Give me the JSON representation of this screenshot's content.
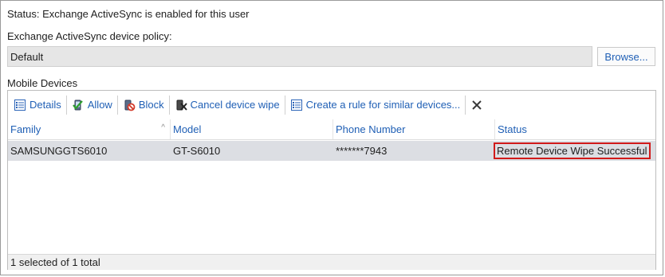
{
  "status_text": "Status: Exchange ActiveSync is enabled for this user",
  "policy": {
    "label": "Exchange ActiveSync device policy:",
    "value": "Default",
    "browse_label": "Browse..."
  },
  "devices": {
    "label": "Mobile Devices",
    "toolbar": {
      "details": "Details",
      "allow": "Allow",
      "block": "Block",
      "cancel_wipe": "Cancel device wipe",
      "create_rule": "Create a rule for similar devices..."
    },
    "columns": [
      "Family",
      "Model",
      "Phone Number",
      "Status"
    ],
    "rows": [
      {
        "family": "SAMSUNGGTS6010",
        "model": "GT-S6010",
        "phone": "*******7943",
        "status": "Remote Device Wipe Successful"
      }
    ],
    "footer": "1 selected of 1 total"
  },
  "colors": {
    "link": "#1f5fb5",
    "selected_row": "#dcdee3",
    "highlight": "#d11a1a"
  }
}
